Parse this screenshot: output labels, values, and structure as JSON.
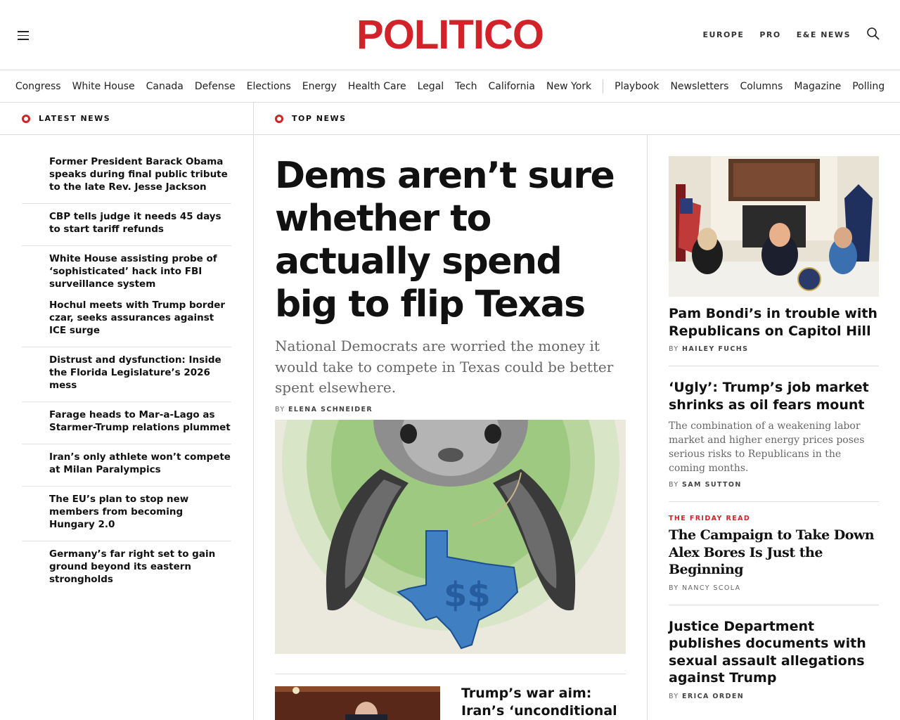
{
  "header": {
    "logo": "POLITICO",
    "util_links": [
      "EUROPE",
      "PRO",
      "E&E NEWS"
    ]
  },
  "section_nav": {
    "primary": [
      "Congress",
      "White House",
      "Canada",
      "Defense",
      "Elections",
      "Energy",
      "Health Care",
      "Legal",
      "Tech",
      "California",
      "New York"
    ],
    "secondary": [
      "Playbook",
      "Newsletters",
      "Columns",
      "Magazine",
      "Polling"
    ]
  },
  "labels": {
    "latest": "LATEST NEWS",
    "top": "TOP NEWS"
  },
  "latest_news": [
    "Former President Barack Obama speaks during final public tribute to the late Rev. Jesse Jackson",
    "CBP tells judge it needs 45 days to start tariff refunds",
    "White House assisting probe of ‘sophisticated’ hack into FBI surveillance system",
    "Hochul meets with Trump border czar, seeks assurances against ICE surge",
    "Distrust and dysfunction: Inside the Florida Legislature’s 2026 mess",
    "Farage heads to Mar-a-Lago as Starmer-Trump relations plummet",
    "Iran’s only athlete won’t compete at Milan Paralympics",
    "The EU’s plan to stop new members from becoming Hungary 2.0",
    "Germany’s far right set to gain ground beyond its eastern strongholds"
  ],
  "top_story": {
    "headline": "Dems aren’t sure whether to actually spend big to flip Texas",
    "dek": "National Democrats are worried the money it would take to compete in Texas could be better spent elsewhere.",
    "byline_prefix": "BY",
    "author": "ELENA SCHNEIDER"
  },
  "second_story": {
    "headline": "Trump’s war aim: Iran’s ‘unconditional surrender’"
  },
  "right_column": [
    {
      "headline": "Pam Bondi’s in trouble with Republicans on Capitol Hill",
      "byline_prefix": "BY",
      "author": "HAILEY FUCHS"
    },
    {
      "headline": "‘Ugly’: Trump’s job market shrinks as oil fears mount",
      "dek": "The combination of a weakening labor market and higher energy prices poses serious risks to Republicans in the coming months.",
      "byline_prefix": "BY",
      "author": "SAM SUTTON"
    },
    {
      "kicker": "THE FRIDAY READ",
      "headline": "The Campaign to Take Down Alex Bores Is Just the Beginning",
      "byline": "BY NANCY SCOLA"
    },
    {
      "headline": "Justice Department publishes documents with sexual assault allegations against Trump",
      "byline_prefix": "BY",
      "author": "ERICA ORDEN"
    }
  ],
  "colors": {
    "brand_red": "#d2232a",
    "text": "#111111",
    "muted": "#666666",
    "border": "#dcdcdc"
  }
}
